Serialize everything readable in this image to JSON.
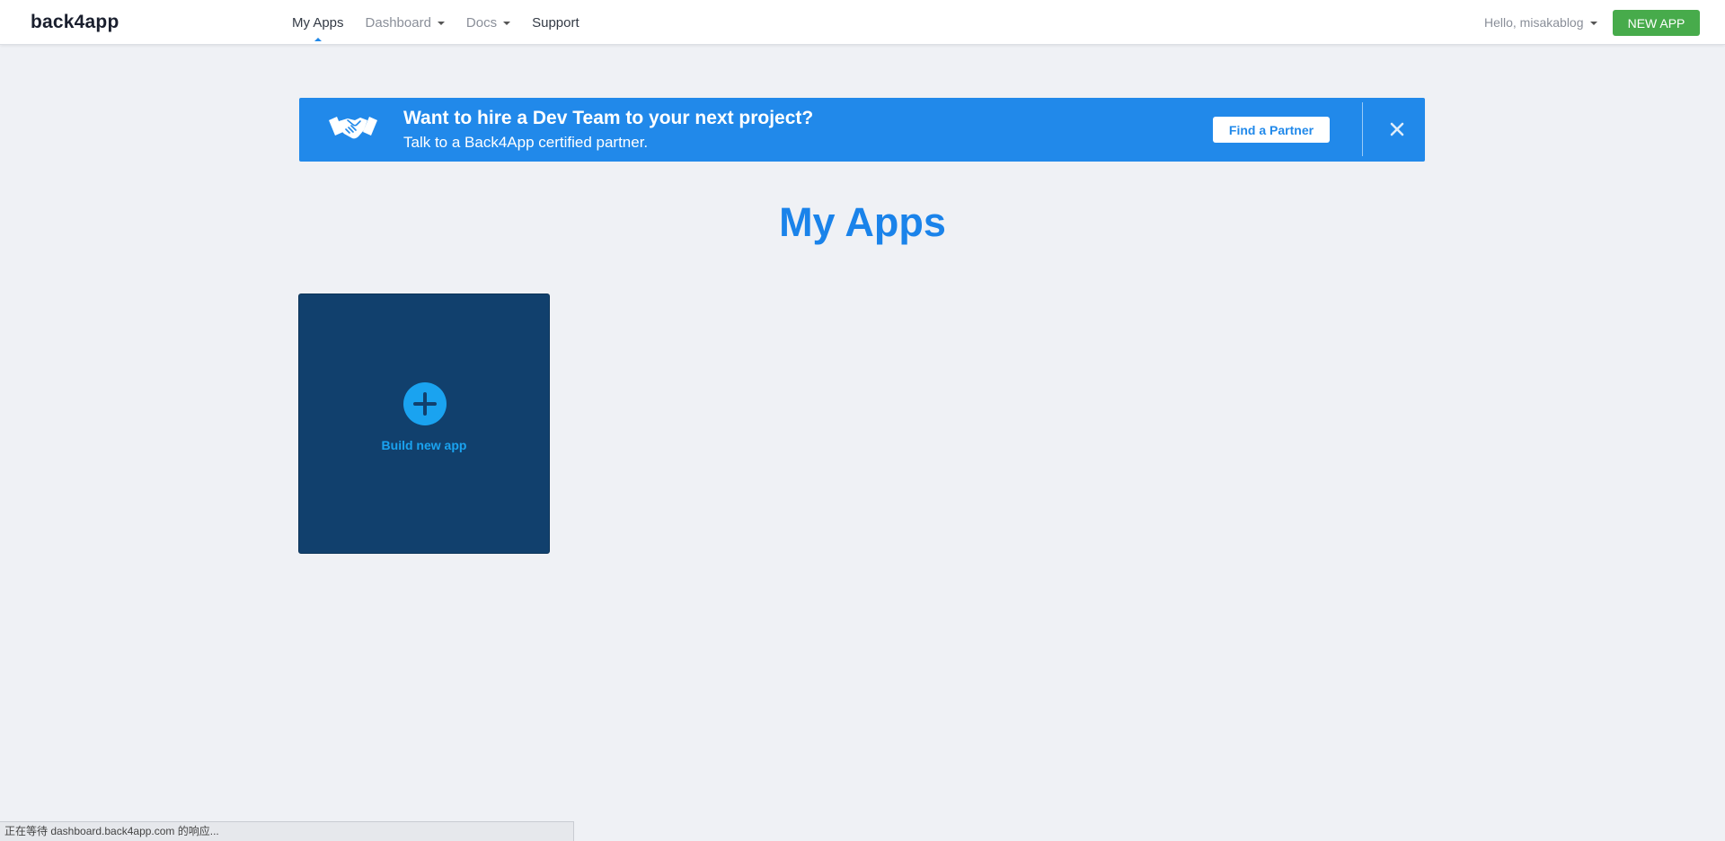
{
  "header": {
    "logo": "back4app",
    "nav": [
      {
        "label": "My Apps",
        "active": true,
        "dropdown": false
      },
      {
        "label": "Dashboard",
        "active": false,
        "dropdown": true
      },
      {
        "label": "Docs",
        "active": false,
        "dropdown": true
      },
      {
        "label": "Support",
        "active": false,
        "dropdown": false
      }
    ],
    "user_greeting": "Hello, misakablog",
    "new_app_label": "NEW APP"
  },
  "banner": {
    "icon": "handshake-icon",
    "title": "Want to hire a Dev Team to your next project?",
    "subtitle": "Talk to a Back4App certified partner.",
    "button_label": "Find a Partner",
    "close_icon": "close-icon",
    "color": "#2189ea"
  },
  "main": {
    "title": "My Apps",
    "cards": [
      {
        "label": "Build new app",
        "icon": "plus-circle-icon"
      }
    ]
  },
  "statusbar": {
    "text": "正在等待 dashboard.back4app.com 的响应..."
  },
  "colors": {
    "accent": "#1a83ea",
    "new_app_button": "#47ab4b",
    "card_background": "#11406d",
    "card_accent": "#1aa3f0",
    "page_background": "#eff1f5"
  }
}
